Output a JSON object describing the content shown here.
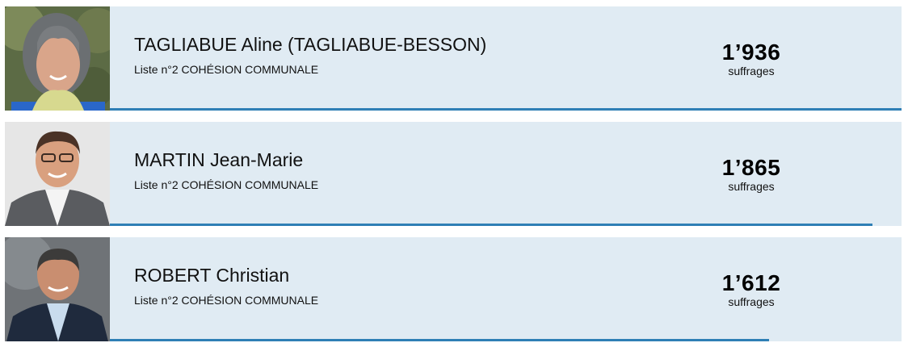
{
  "candidates": [
    {
      "name": "TAGLIABUE Aline (TAGLIABUE-BESSON)",
      "list": "Liste n°2 COHÉSION COMMUNALE",
      "votes": "1’936",
      "votes_unit": "suffrages",
      "votes_value": 1936
    },
    {
      "name": "MARTIN Jean-Marie",
      "list": "Liste n°2 COHÉSION COMMUNALE",
      "votes": "1’865",
      "votes_unit": "suffrages",
      "votes_value": 1865
    },
    {
      "name": "ROBERT Christian",
      "list": "Liste n°2 COHÉSION COMMUNALE",
      "votes": "1’612",
      "votes_unit": "suffrages",
      "votes_value": 1612
    }
  ],
  "colors": {
    "row_background": "#e0ebf3",
    "bar": "#2f7fb5"
  }
}
